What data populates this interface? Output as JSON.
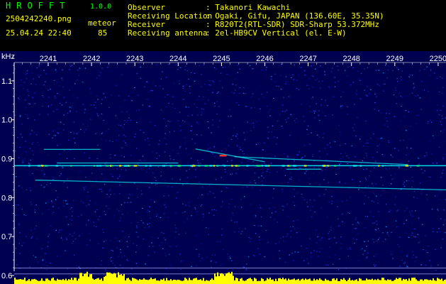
{
  "header": {
    "app_title": "HROFFT",
    "app_version": "1.0.0",
    "filename": "2504242240.png",
    "datetime": "25.04.24 22:40",
    "meteor_label": "meteor",
    "meteor_count": "85"
  },
  "info": [
    {
      "key": "Observer",
      "value": ": Takanori Kawachi"
    },
    {
      "key": "Receiving Location",
      "value": ": Ogaki, Gifu, JAPAN (136.60E, 35.35N)"
    },
    {
      "key": "Receiver",
      "value": ": R820T2(RTL-SDR) SDR-Sharp 53.372MHz"
    },
    {
      "key": "Receiving antenna",
      "value": ": 2el-HB9CV Vertical (el. E-W)"
    }
  ],
  "chart_data": {
    "type": "heatmap",
    "ylabel": "kHz",
    "x_ticks": [
      "2241",
      "2242",
      "2243",
      "2244",
      "2245",
      "2246",
      "2247",
      "2248",
      "2249",
      "2250"
    ],
    "y_ticks": [
      "1.1",
      "1.0",
      "0.9",
      "0.8",
      "0.7",
      "0.6"
    ],
    "ylim": [
      0.6,
      1.18
    ],
    "colors": {
      "background": "#000050",
      "axis": "#ffffff",
      "noise": "#1a3cff",
      "signal": "#00ffff",
      "hot": "#ff3030",
      "level": "#ffff00"
    },
    "signals": [
      {
        "freq": 0.882,
        "kind": "carrier"
      },
      {
        "freq": 0.924,
        "kind": "trail",
        "x_start": 2240.9,
        "x_end": 2242.2
      },
      {
        "freq": 0.925,
        "kind": "trail",
        "x_start": 2244.4,
        "x_end": 2246.0,
        "freq_end": 0.892
      },
      {
        "freq": 0.905,
        "kind": "trail",
        "x_start": 2245.3,
        "x_end": 2249.3,
        "freq_end": 0.885
      },
      {
        "freq": 0.889,
        "kind": "trail",
        "x_start": 2241.2,
        "x_end": 2244.0
      },
      {
        "freq": 0.845,
        "kind": "trail",
        "x_start": 2240.7,
        "x_end": 2250.2,
        "freq_end": 0.82
      },
      {
        "freq": 0.873,
        "kind": "trail",
        "x_start": 2246.5,
        "x_end": 2247.3
      },
      {
        "freq": 0.619,
        "kind": "reference"
      },
      {
        "freq": 0.604,
        "kind": "reference"
      }
    ]
  }
}
